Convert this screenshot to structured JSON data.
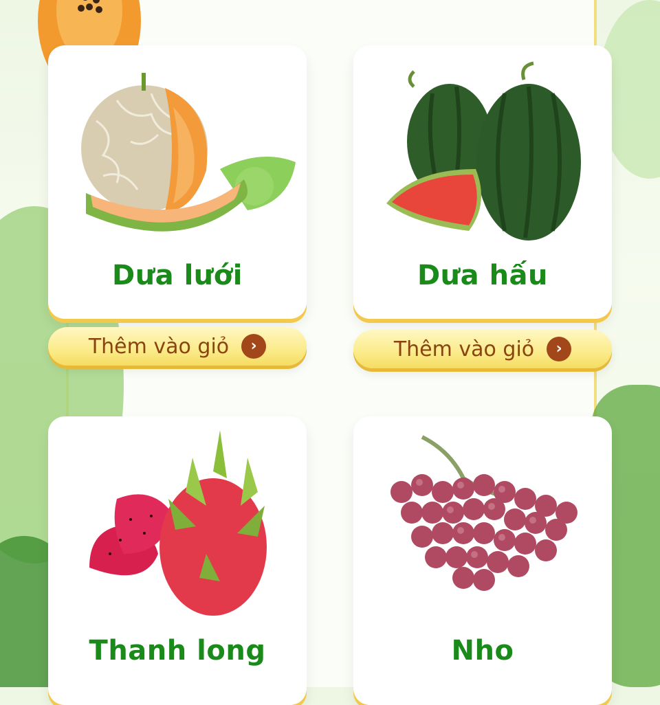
{
  "products": [
    {
      "name": "Dưa lưới",
      "button_label": "Thêm vào giỏ"
    },
    {
      "name": "Dưa hấu",
      "button_label": "Thêm vào giỏ"
    },
    {
      "name": "Thanh long"
    },
    {
      "name": "Nho"
    }
  ],
  "icons": {
    "button_arrow": "chevron-right-icon"
  },
  "colors": {
    "product_name": "#1a8a1a",
    "button_text": "#8a4410",
    "button_fill": "#fbeb8a",
    "arrow_circle": "#a2471a"
  }
}
